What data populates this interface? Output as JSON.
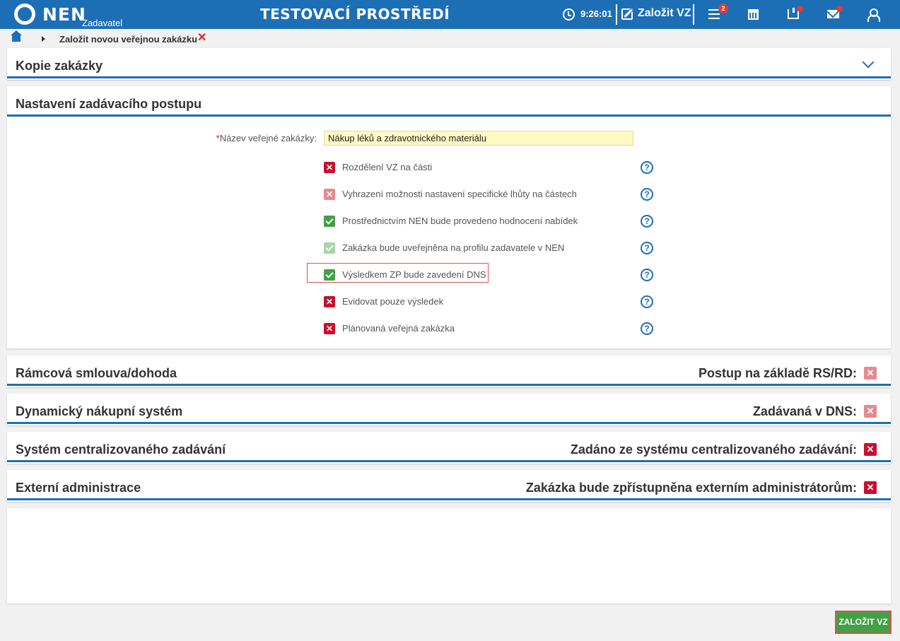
{
  "header": {
    "brand": "NEN",
    "brand_sub": "Zadavatel",
    "env_title": "TESTOVACÍ PROSTŘEDÍ",
    "time": "9:26:01",
    "create_label": "Založit VZ",
    "menu_badge": "2",
    "icons": [
      "clock-icon",
      "edit-icon",
      "menu-icon",
      "calculator-icon",
      "inbox-icon",
      "mail-icon",
      "user-icon"
    ]
  },
  "breadcrumb": {
    "current": "Založit novou veřejnou zakázku"
  },
  "sections": {
    "copy": {
      "title": "Kopie zakázky"
    },
    "settings": {
      "title": "Nastavení zadávacího postupu",
      "name_label": "Název veřejné zakázky:",
      "name_required_mark": "*",
      "name_value": "Nákup léků a zdravotnického materiálu",
      "options": [
        {
          "label": "Rozdělení VZ na části",
          "state": "no",
          "style": "dark"
        },
        {
          "label": "Vyhrazení možnosti nastavení specifické lhůty na částech",
          "state": "no",
          "style": "light"
        },
        {
          "label": "Prostřednictvím NEN bude provedeno hodnocení nabídek",
          "state": "yes",
          "style": "dark"
        },
        {
          "label": "Zakázka bude uveřejněna na profilu zadavatele v NEN",
          "state": "yes",
          "style": "light"
        },
        {
          "label": "Výsledkem ZP bude zavedení DNS",
          "state": "yes",
          "style": "dark"
        },
        {
          "label": "Evidovat pouze výsledek",
          "state": "no",
          "style": "dark"
        },
        {
          "label": "Plánovaná veřejná zakázka",
          "state": "no",
          "style": "dark"
        }
      ],
      "help_glyph": "?"
    },
    "framework": {
      "title": "Rámcová smlouva/dohoda",
      "right_label": "Postup na základě RS/RD:",
      "state": "no",
      "style": "light"
    },
    "dns": {
      "title": "Dynamický nákupní systém",
      "right_label": "Zadávaná v DNS:",
      "state": "no",
      "style": "light"
    },
    "central": {
      "title": "Systém centralizovaného zadávání",
      "right_label": "Zadáno ze systému centralizovaného zadávání:",
      "state": "no",
      "style": "dark"
    },
    "external": {
      "title": "Externí administrace",
      "right_label": "Zakázka bude zpřístupněna externím administrátorům:",
      "state": "no",
      "style": "dark"
    }
  },
  "submit_label": "ZALOŽIT VZ",
  "colors": {
    "brand_blue": "#1d6fb5",
    "no_dark": "#c8102e",
    "no_light": "#e68a8e",
    "yes_dark": "#43a047",
    "yes_light": "#a5d6a7"
  }
}
